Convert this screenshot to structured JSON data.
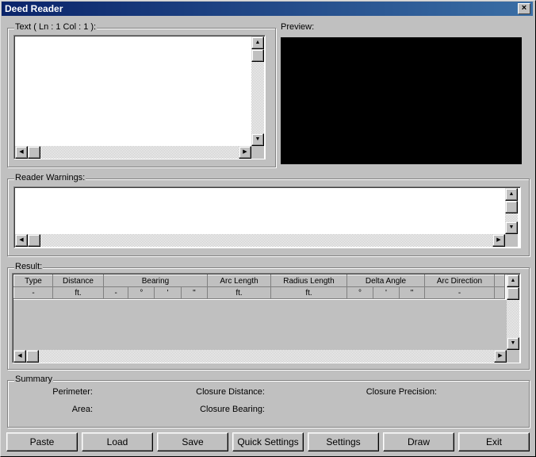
{
  "window": {
    "title": "Deed Reader",
    "close_glyph": "×"
  },
  "text_panel": {
    "label": "Text  ( Ln : 1 Col : 1 ):"
  },
  "preview_panel": {
    "label": "Preview:",
    "background": "#000000"
  },
  "warnings_panel": {
    "label": "Reader Warnings:"
  },
  "result_panel": {
    "label": "Result:",
    "columns": [
      "Type",
      "Distance",
      "Bearing",
      "Arc Length",
      "Radius Length",
      "Delta Angle",
      "Arc Direction"
    ],
    "units": [
      "-",
      "ft.",
      "-",
      "°",
      "'",
      "\"",
      "ft.",
      "ft.",
      "°",
      "'",
      "\"",
      "-"
    ]
  },
  "summary": {
    "label": "Summary",
    "perimeter_label": "Perimeter:",
    "area_label": "Area:",
    "closure_distance_label": "Closure Distance:",
    "closure_bearing_label": "Closure Bearing:",
    "closure_precision_label": "Closure Precision:"
  },
  "buttons": {
    "paste": "Paste",
    "load": "Load",
    "save": "Save",
    "quick_settings": "Quick Settings",
    "settings": "Settings",
    "draw": "Draw",
    "exit": "Exit"
  },
  "glyphs": {
    "up": "▲",
    "down": "▼",
    "left": "◀",
    "right": "▶"
  }
}
